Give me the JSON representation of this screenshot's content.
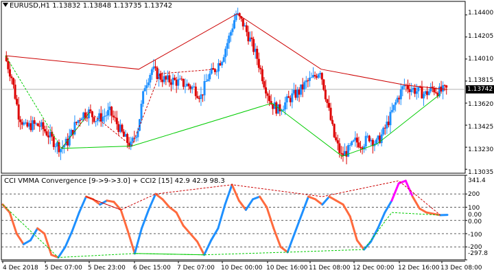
{
  "main_panel": {
    "title": "EURUSD,H1  1.13832 1.13848 1.13735 1.13742",
    "current_price": "1.13742",
    "price_ticks": [
      "1.14400",
      "1.14205",
      "1.14010",
      "1.13815",
      "1.13620",
      "1.13425",
      "1.13230",
      "1.13035"
    ]
  },
  "sub_panel": {
    "title": "CCI VMMA Convergence [9->9->3.0] + CCI2 [15] 42.9 42.9 98.3",
    "ticks": [
      "341.4",
      "200",
      "100",
      "0.00",
      "0.00",
      "-100",
      "-200",
      "-297.8"
    ]
  },
  "time_axis": [
    "4 Dec 2018",
    "5 Dec 07:00",
    "5 Dec 23:00",
    "6 Dec 15:00",
    "7 Dec 07:00",
    "10 Dec 00:00",
    "10 Dec 16:00",
    "11 Dec 08:00",
    "12 Dec 00:00",
    "12 Dec 16:00",
    "13 Dec 08:00"
  ],
  "colors": {
    "bull": "#1E90FF",
    "bear": "#DD0000",
    "up_trend": "#00CC00",
    "down_trend": "#CC0000",
    "cci_orange": "#FF6A3D",
    "cci_blue": "#1E90FF",
    "cci_magenta": "#FF00FF",
    "cci_dark": "#550000"
  },
  "chart_data": [
    {
      "type": "candlestick",
      "title": "EURUSD,H1",
      "ylim": [
        1.13,
        1.1452
      ],
      "close_path": [
        1.1404,
        1.1385,
        1.1352,
        1.134,
        1.1343,
        1.1342,
        1.1336,
        1.1328,
        1.1322,
        1.1328,
        1.1342,
        1.1352,
        1.1354,
        1.1348,
        1.135,
        1.1354,
        1.1344,
        1.1332,
        1.1324,
        1.134,
        1.1378,
        1.1392,
        1.1386,
        1.1382,
        1.1382,
        1.138,
        1.1378,
        1.1375,
        1.1368,
        1.1385,
        1.1392,
        1.1402,
        1.142,
        1.1441,
        1.1432,
        1.1418,
        1.1402,
        1.138,
        1.1362,
        1.1356,
        1.1362,
        1.1368,
        1.1372,
        1.138,
        1.1384,
        1.1392,
        1.1362,
        1.1332,
        1.1315,
        1.132,
        1.1328,
        1.1326,
        1.1332,
        1.1326,
        1.1336,
        1.135,
        1.1366,
        1.1378,
        1.1375,
        1.1372,
        1.137,
        1.1375,
        1.1372,
        1.1374
      ]
    },
    {
      "type": "line",
      "title": "CCI VMMA Convergence [9->9->3.0] + CCI2 [15]",
      "ylim": [
        -297.8,
        341.4
      ],
      "values": [
        120,
        60,
        -100,
        -180,
        -150,
        -60,
        -100,
        -260,
        -280,
        -200,
        -80,
        60,
        180,
        160,
        120,
        150,
        140,
        80,
        -80,
        -250,
        -60,
        80,
        200,
        160,
        100,
        60,
        -40,
        -100,
        -160,
        -260,
        -150,
        -60,
        120,
        270,
        150,
        80,
        160,
        180,
        100,
        -60,
        -200,
        -240,
        -100,
        40,
        180,
        160,
        120,
        180,
        150,
        120,
        30,
        -150,
        -220,
        -160,
        -60,
        60,
        150,
        280,
        300,
        180,
        90,
        60,
        50,
        40,
        42
      ]
    }
  ]
}
